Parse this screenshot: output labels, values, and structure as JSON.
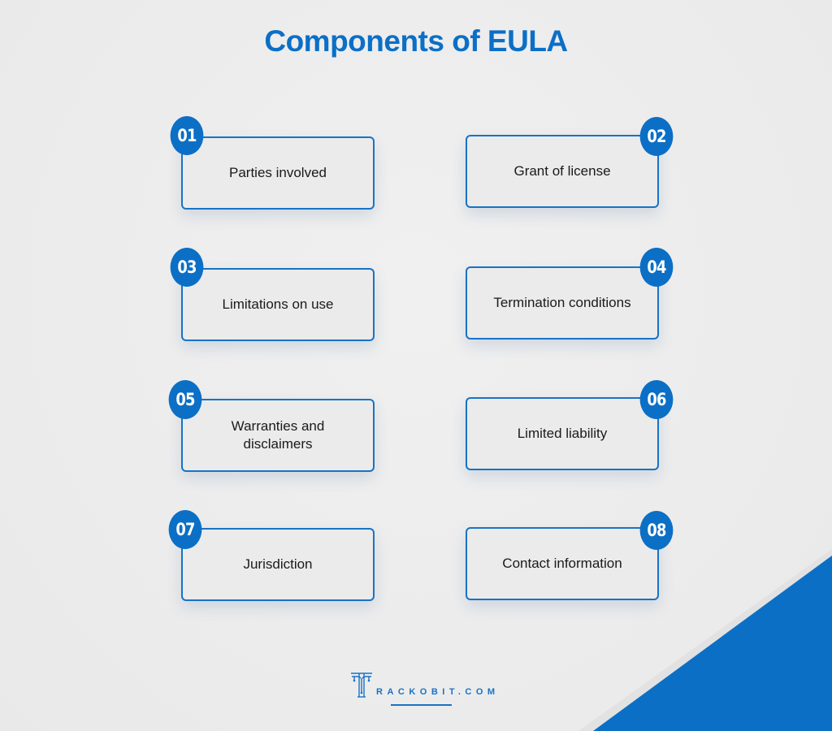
{
  "title": "Components of EULA",
  "colors": {
    "accent": "#0b6fc6",
    "background": "#ececec",
    "text": "#1a1a1a"
  },
  "items": [
    {
      "number": "01",
      "label": "Parties involved"
    },
    {
      "number": "02",
      "label": "Grant of license"
    },
    {
      "number": "03",
      "label": "Limitations on use"
    },
    {
      "number": "04",
      "label": "Termination conditions"
    },
    {
      "number": "05",
      "label": "Warranties and disclaimers"
    },
    {
      "number": "06",
      "label": "Limited liability"
    },
    {
      "number": "07",
      "label": "Jurisdiction"
    },
    {
      "number": "08",
      "label": "Contact information"
    }
  ],
  "logo": {
    "text": "RACKOBIT.COM",
    "icon": "trackobit-t-circuit-icon"
  }
}
